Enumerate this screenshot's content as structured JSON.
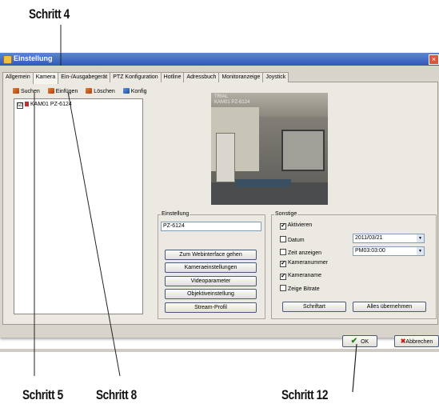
{
  "callouts": {
    "step4": "Schritt 4",
    "step5": "Schritt 5",
    "step8": "Schritt 8",
    "step12": "Schritt 12"
  },
  "window": {
    "title": "Einstellung",
    "close": "×"
  },
  "tabs": [
    "Allgemein",
    "Kamera",
    "Ein-/Ausgabegerät",
    "PTZ Konfiguration",
    "Hotline",
    "Adressbuch",
    "Monitoranzeige",
    "Joystick"
  ],
  "toolbar": {
    "search": "Suchen",
    "insert": "Einfügen",
    "delete": "Löschen",
    "config": "Konfig"
  },
  "tree": {
    "item": "KAM01 PZ-6124",
    "checked": "☑"
  },
  "video": {
    "osd_line1": "TRIAL",
    "osd_line2": "KAM01 PZ-6124"
  },
  "settings": {
    "label": "Einstellung",
    "model_value": "PZ-6124",
    "buttons": [
      "Zum Webinterface gehen",
      "Kameraeinstellungen",
      "Videoparameter",
      "Objektiveinstellung",
      "Stream-Profil"
    ]
  },
  "misc": {
    "label": "Sonstige",
    "activate": "Aktivieren",
    "date": "Datum",
    "show_time": "Zeit anzeigen",
    "camera_number": "Kameranummer",
    "camera_name": "Kameraname",
    "show_bitrate": "Zeige Bitrate",
    "date_value": "2011/03/21",
    "time_value": "PM03:03:00",
    "font_button": "Schriftart",
    "apply_all_button": "Alles übernehmen",
    "check": "✔"
  },
  "footer": {
    "ok": "OK",
    "cancel": "Abbrechen",
    "ok_icon": "✔",
    "cancel_icon": "✖"
  },
  "colors": {
    "titlebar": "#2f59b8",
    "ok_check": "#208020",
    "cancel_x": "#c02020"
  }
}
